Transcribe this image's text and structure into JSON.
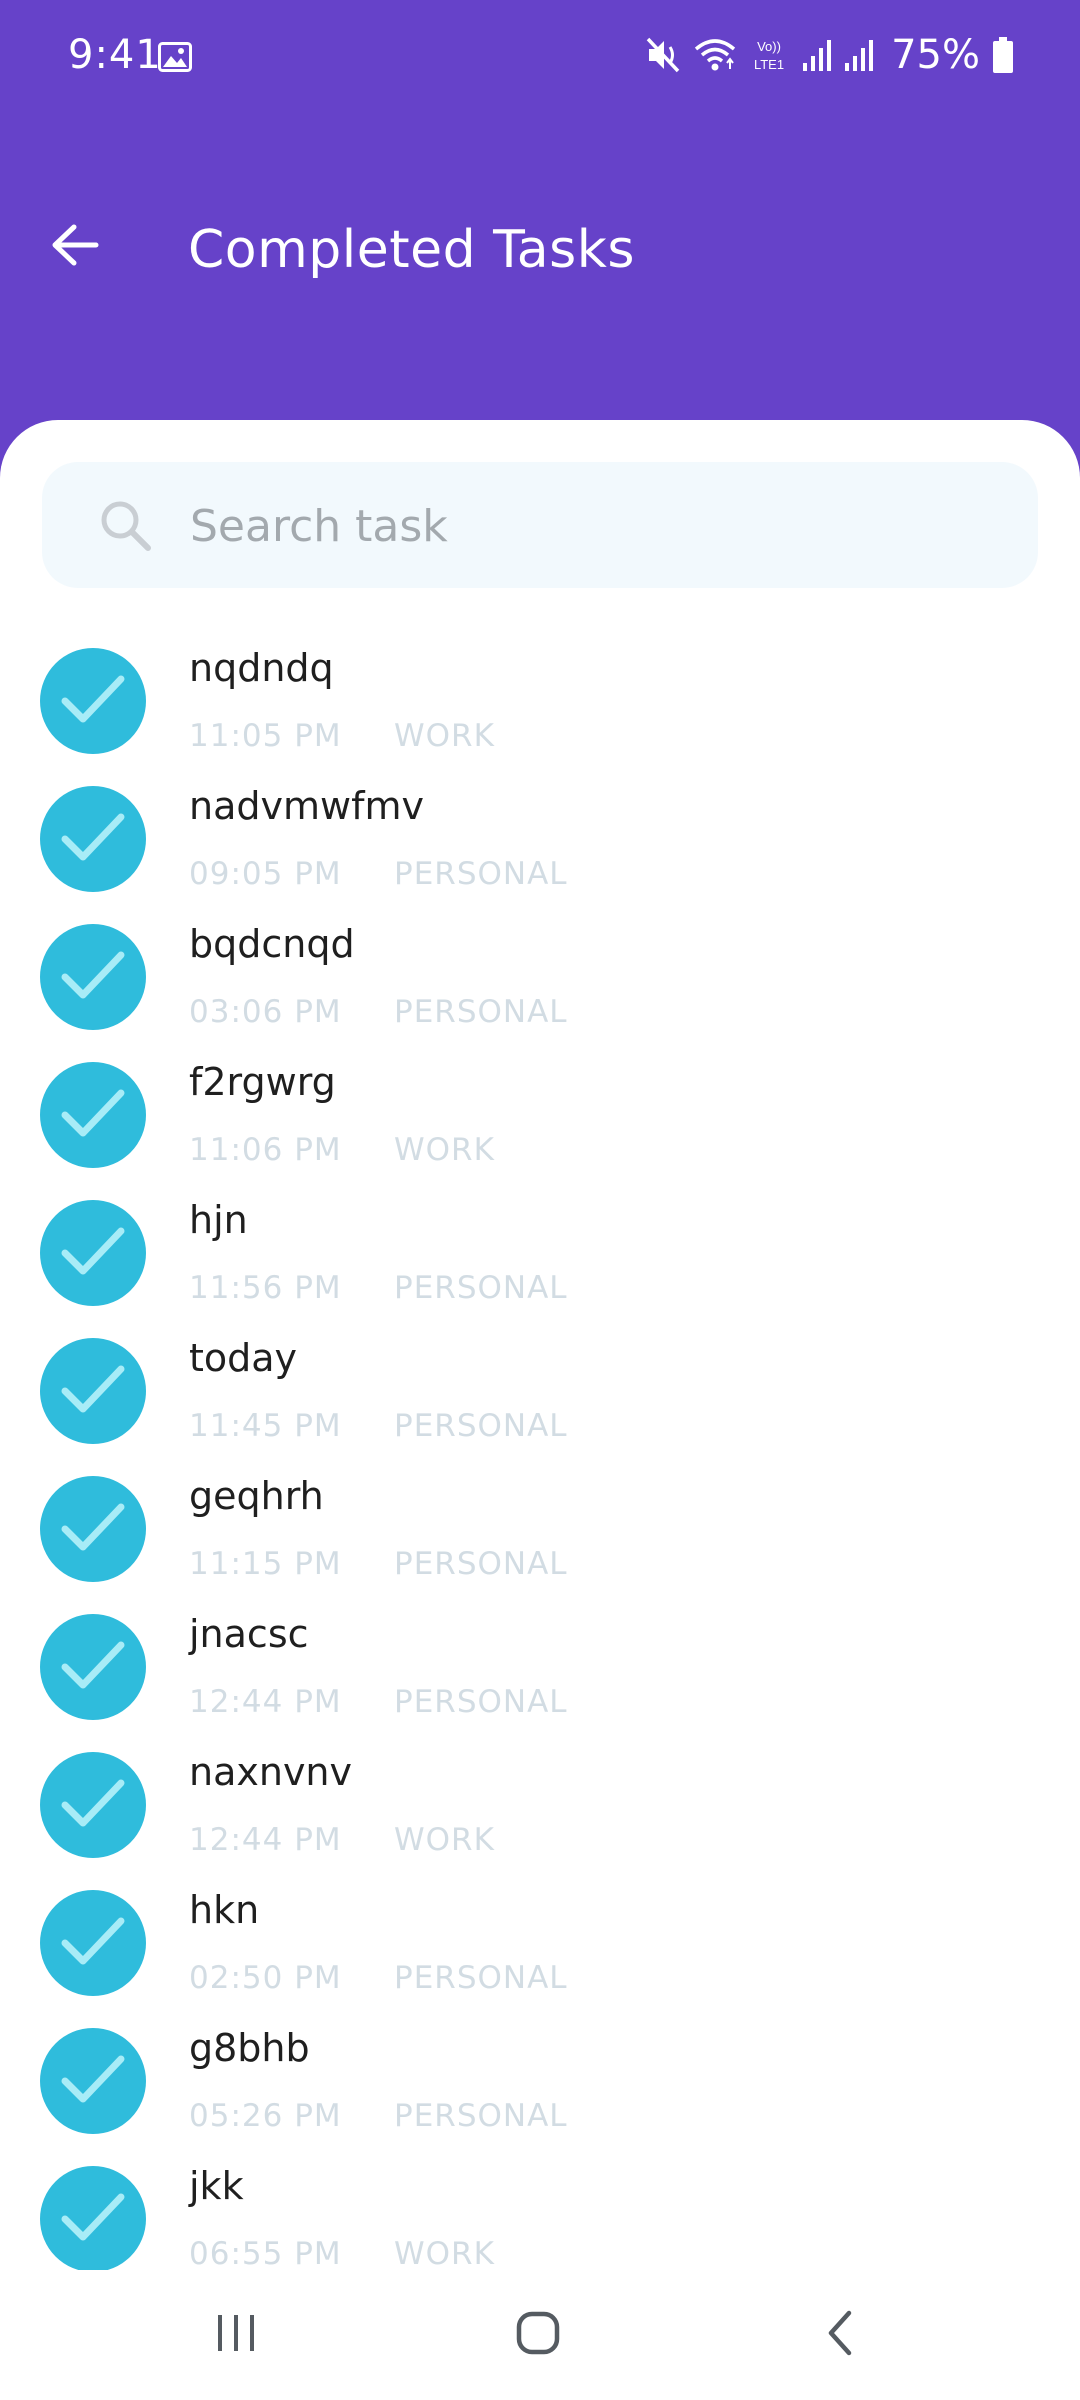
{
  "status_bar": {
    "time": "9:41",
    "battery": "75%",
    "network_label": "Vo)) LTE1",
    "icons": [
      "gallery-icon",
      "mute-icon",
      "wifi-icon",
      "volte-icon",
      "signal-icon",
      "signal-icon",
      "battery-icon"
    ]
  },
  "app_bar": {
    "title": "Completed Tasks",
    "back_icon": "arrow-left-icon",
    "background_color": "#6642c9"
  },
  "search": {
    "placeholder": "Search task",
    "value": "",
    "icon": "search-icon"
  },
  "tasks": [
    {
      "title": "nqdndq",
      "time": "11:05 PM",
      "category": "WORK",
      "completed": true
    },
    {
      "title": "nadvmwfmv",
      "time": "09:05 PM",
      "category": "PERSONAL",
      "completed": true
    },
    {
      "title": "bqdcnqd",
      "time": "03:06 PM",
      "category": "PERSONAL",
      "completed": true
    },
    {
      "title": "f2rgwrg",
      "time": "11:06 PM",
      "category": "WORK",
      "completed": true
    },
    {
      "title": "hjn",
      "time": "11:56 PM",
      "category": "PERSONAL",
      "completed": true
    },
    {
      "title": "today",
      "time": "11:45 PM",
      "category": "PERSONAL",
      "completed": true
    },
    {
      "title": "geqhrh",
      "time": "11:15 PM",
      "category": "PERSONAL",
      "completed": true
    },
    {
      "title": "jnacsc",
      "time": "12:44 PM",
      "category": "PERSONAL",
      "completed": true
    },
    {
      "title": "naxnvnv",
      "time": "12:44 PM",
      "category": "WORK",
      "completed": true
    },
    {
      "title": "hkn",
      "time": "02:50 PM",
      "category": "PERSONAL",
      "completed": true
    },
    {
      "title": "g8bhb",
      "time": "05:26 PM",
      "category": "PERSONAL",
      "completed": true
    },
    {
      "title": "jkk",
      "time": "06:55 PM",
      "category": "WORK",
      "completed": true
    }
  ],
  "colors": {
    "accent": "#6642c9",
    "check": "#2fbcdc",
    "check_mark": "#a8ecf7",
    "meta_text": "#d2dce3"
  },
  "nav_bar": {
    "buttons": [
      "recents-icon",
      "home-icon",
      "back-icon"
    ]
  }
}
